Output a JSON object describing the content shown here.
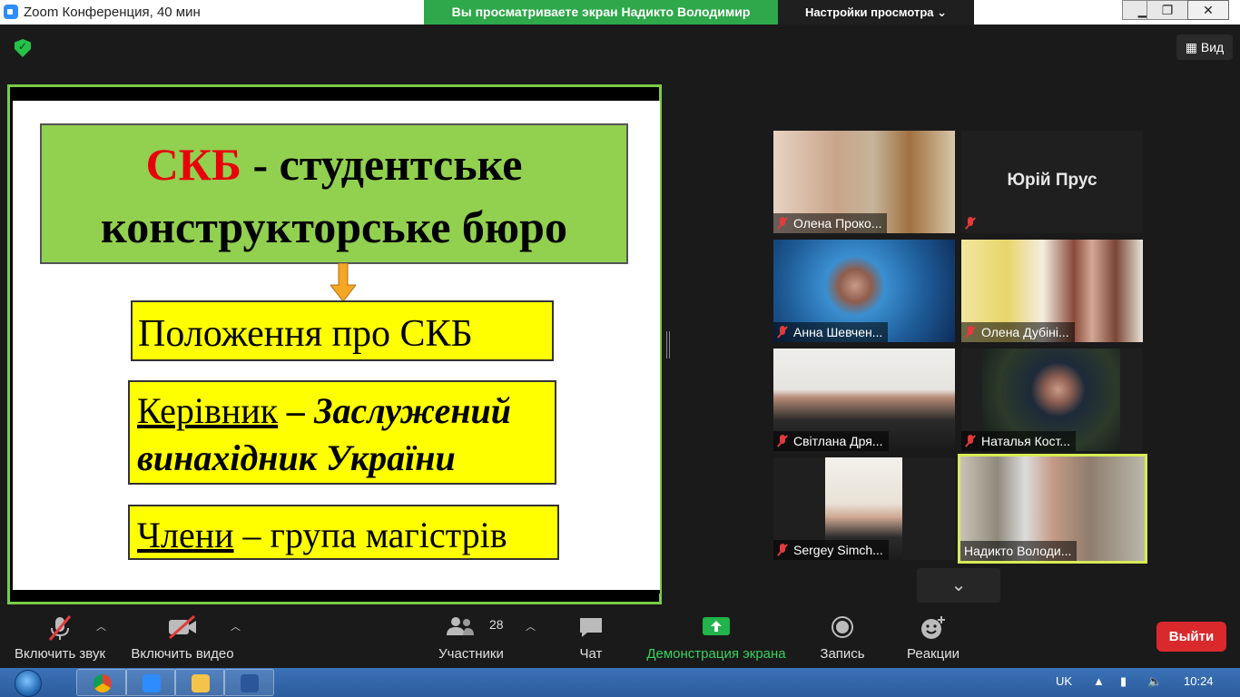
{
  "titlebar": {
    "title": "Zoom Конференция, 40 мин",
    "share_banner": "Вы просматриваете экран Надикто Володимир",
    "view_settings": "Настройки просмотра ⌄",
    "min": "▁",
    "max": "❐",
    "close": "✕"
  },
  "view_button": {
    "label": "Вид"
  },
  "slide": {
    "title_red": "СКБ",
    "title_rest": " - студентське",
    "title_line2": "конструкторське бюро",
    "box1": "Положення про СКБ",
    "box2_underlined": "Керівник",
    "box2_rest": " – Заслужений",
    "box2_line2": "винахідник України",
    "box3_underlined": "Члени",
    "box3_rest": " – група магістрів"
  },
  "participants": [
    {
      "name": "Олена Проко...",
      "muted": true
    },
    {
      "name": "",
      "muted": true,
      "display_name": "Юрій Прус"
    },
    {
      "name": "Анна Шевчен...",
      "muted": true
    },
    {
      "name": "Олена Дубіні...",
      "muted": true
    },
    {
      "name": "Світлана Дря...",
      "muted": true
    },
    {
      "name": "Наталья Кост...",
      "muted": true
    },
    {
      "name": "Sergey Simch...",
      "muted": true
    },
    {
      "name": "Надикто Володи...",
      "muted": false
    }
  ],
  "toolbar": {
    "audio_label": "Включить звук",
    "video_label": "Включить видео",
    "participants_label": "Участники",
    "participants_count": "28",
    "chat_label": "Чат",
    "share_label": "Демонстрация экрана",
    "record_label": "Запись",
    "reactions_label": "Реакции",
    "leave_label": "Выйти"
  },
  "taskbar": {
    "lang": "UK",
    "time": "10:24"
  },
  "colors": {
    "zoom_green": "#2ea84a",
    "slide_green": "#92d050",
    "slide_yellow": "#ffff00",
    "slide_red": "#e8000b",
    "leave_red": "#d9292d",
    "active_speaker": "#d7ec55"
  }
}
